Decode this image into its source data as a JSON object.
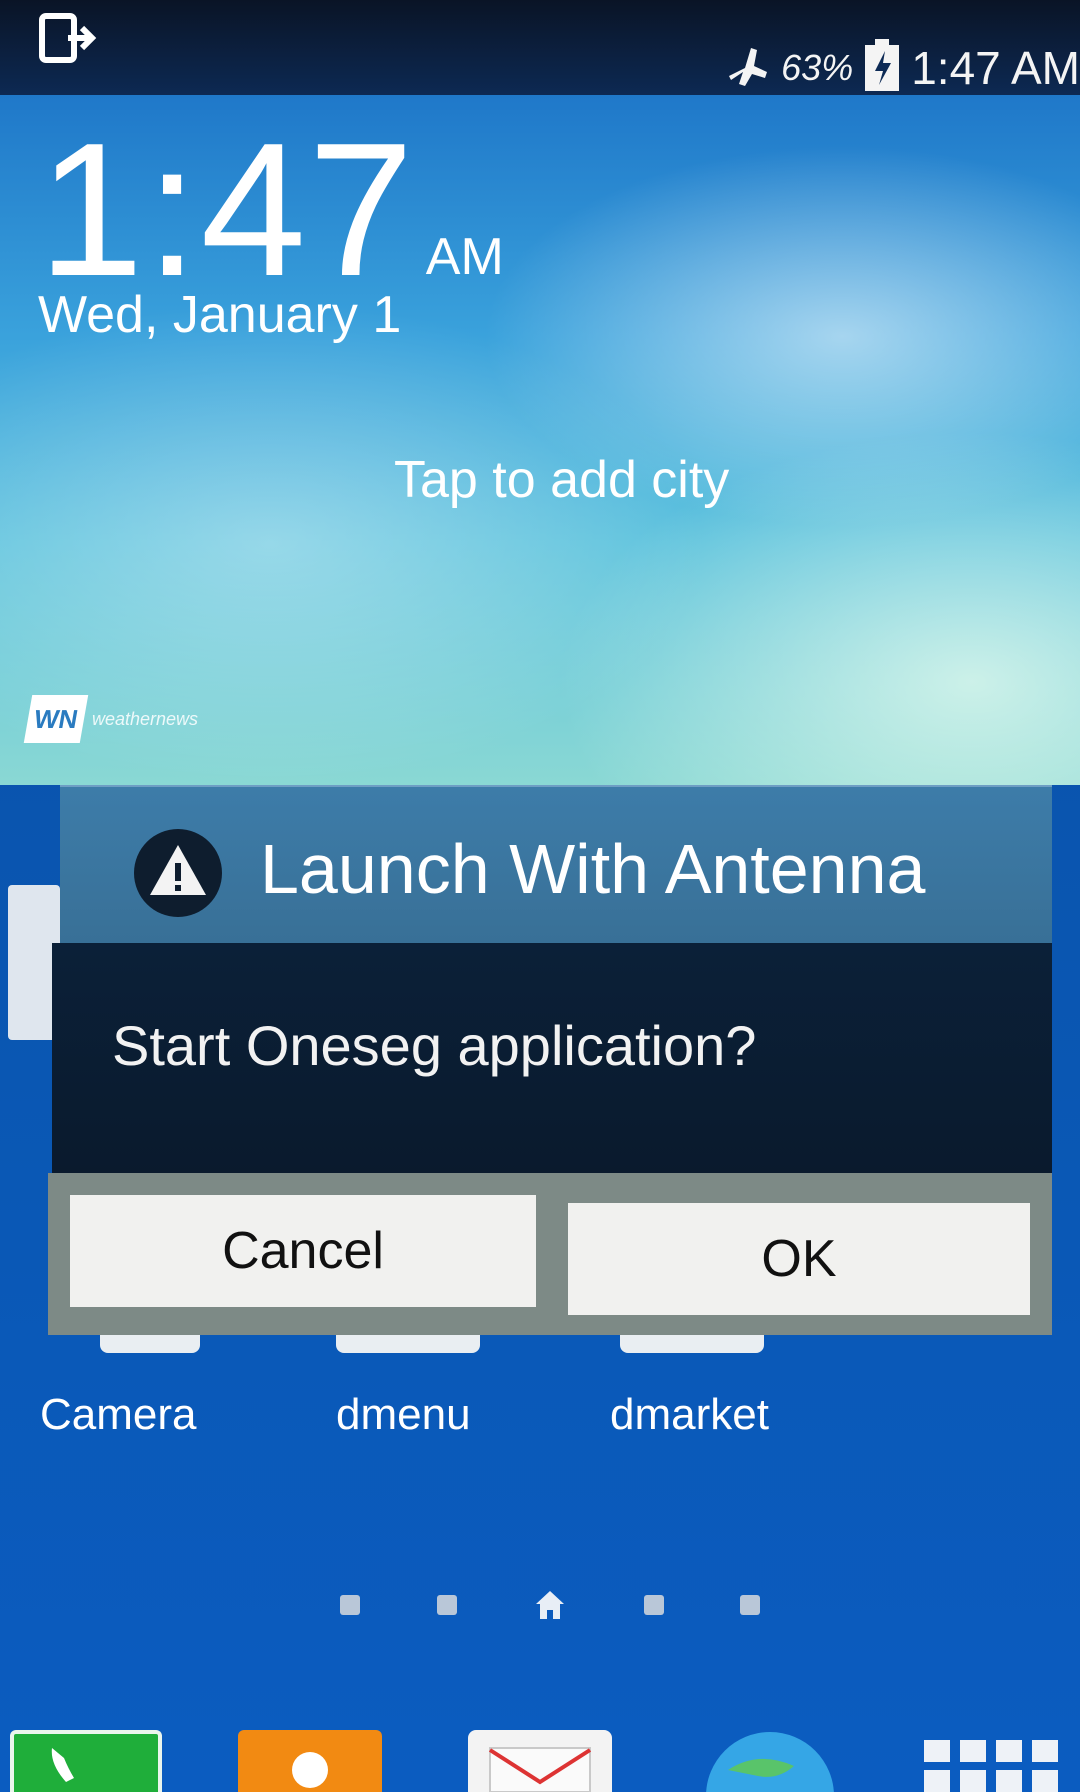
{
  "status_bar": {
    "battery_percent": "63%",
    "time": "1:47 AM"
  },
  "weather_widget": {
    "time": "1:47",
    "ampm": "AM",
    "date": "Wed, January 1",
    "prompt": "Tap to add city",
    "logo_badge": "WN",
    "logo_text": "weathernews"
  },
  "dialog": {
    "title": "Launch With Antenna",
    "message": "Start Oneseg application?",
    "cancel_label": "Cancel",
    "ok_label": "OK"
  },
  "apps": [
    {
      "label": "Camera"
    },
    {
      "label": "dmenu"
    },
    {
      "label": "dmarket"
    }
  ],
  "page_indicator": {
    "pages": 5,
    "current": 3
  },
  "dock": [
    {
      "icon": "phone-icon"
    },
    {
      "icon": "contacts-icon"
    },
    {
      "icon": "email-icon"
    },
    {
      "icon": "internet-icon"
    },
    {
      "icon": "apps-grid-icon"
    }
  ],
  "colors": {
    "status_bar": "#0a1426",
    "dialog_title_bar": "#3d7ca9",
    "dialog_body": "#0b2038",
    "button_bg": "#f1f1ef",
    "home_background": "#0b56b3"
  }
}
